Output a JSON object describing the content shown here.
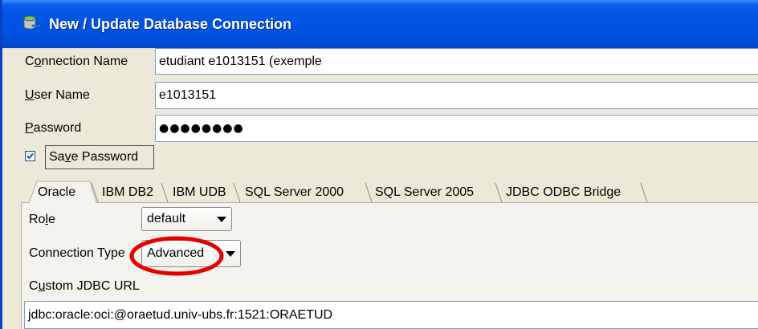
{
  "window": {
    "title": "New / Update Database Connection",
    "title_icon": "database-connection-icon"
  },
  "form": {
    "connection_name": {
      "label": "Connection Name",
      "mnemonic": 1,
      "value": "etudiant e1013151 (exemple"
    },
    "user_name": {
      "label": "User Name",
      "mnemonic": 0,
      "value": "e1013151"
    },
    "password": {
      "label": "Password",
      "mnemonic": 0,
      "value": "●●●●●●●●"
    },
    "save_password": {
      "label": "Save Password",
      "mnemonic": 2,
      "checked": true
    }
  },
  "tabs": [
    {
      "label": "Oracle",
      "selected": true
    },
    {
      "label": "IBM DB2",
      "selected": false
    },
    {
      "label": "IBM UDB",
      "selected": false
    },
    {
      "label": "SQL Server 2000",
      "selected": false
    },
    {
      "label": "SQL Server 2005",
      "selected": false
    },
    {
      "label": "JDBC ODBC Bridge",
      "selected": false
    }
  ],
  "oracle_tab": {
    "role": {
      "label": "Role",
      "mnemonic": 2,
      "value": "default"
    },
    "connection_type": {
      "label": "Connection Type",
      "mnemonic": -1,
      "value": "Advanced"
    },
    "custom_jdbc_url": {
      "label": "Custom JDBC URL",
      "mnemonic": 1,
      "value": "jdbc:oracle:oci:@oraetud.univ-ubs.fr:1521:ORAETUD"
    }
  },
  "icons": {
    "title": "database-connection-icon",
    "checkbox": "check-icon",
    "combo_arrow": "chevron-down-icon"
  },
  "colors": {
    "title_bar": "#0055E5",
    "dialog_bg": "#ECE9D8",
    "panel_bg": "#F4F3EE",
    "field_border": "#7F9DB9",
    "annotation": "#E50000",
    "checkbox_mark": "#1F56A8"
  }
}
